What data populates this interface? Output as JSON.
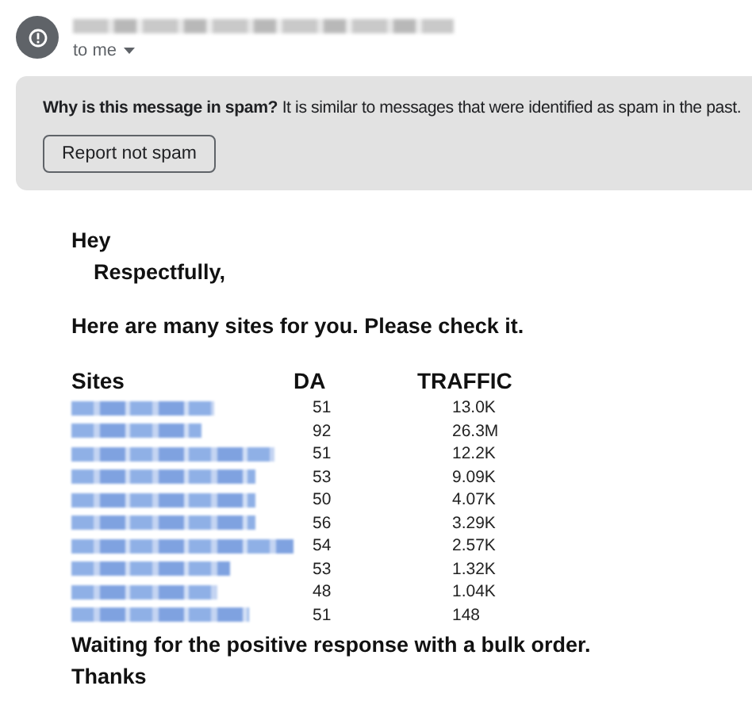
{
  "header": {
    "recipient": "to me"
  },
  "spam_banner": {
    "question": "Why is this message in spam?",
    "explanation": "It is similar to messages that were identified as spam in the past.",
    "button": "Report not spam"
  },
  "body": {
    "greeting": "Hey",
    "salutation": "Respectfully,",
    "intro": "Here are many sites for you. Please check it.",
    "table": {
      "columns": [
        "Sites",
        "DA",
        "TRAFFIC"
      ],
      "rows": [
        {
          "da": "51",
          "traffic": "13.0K"
        },
        {
          "da": "92",
          "traffic": "26.3M"
        },
        {
          "da": "51",
          "traffic": "12.2K"
        },
        {
          "da": "53",
          "traffic": "9.09K"
        },
        {
          "da": "50",
          "traffic": "4.07K"
        },
        {
          "da": "56",
          "traffic": "3.29K"
        },
        {
          "da": "54",
          "traffic": "2.57K"
        },
        {
          "da": "53",
          "traffic": "1.32K"
        },
        {
          "da": "48",
          "traffic": "1.04K"
        },
        {
          "da": "51",
          "traffic": "148"
        }
      ]
    },
    "closing": "Waiting for the positive response with a bulk order.",
    "signoff": "Thanks"
  }
}
